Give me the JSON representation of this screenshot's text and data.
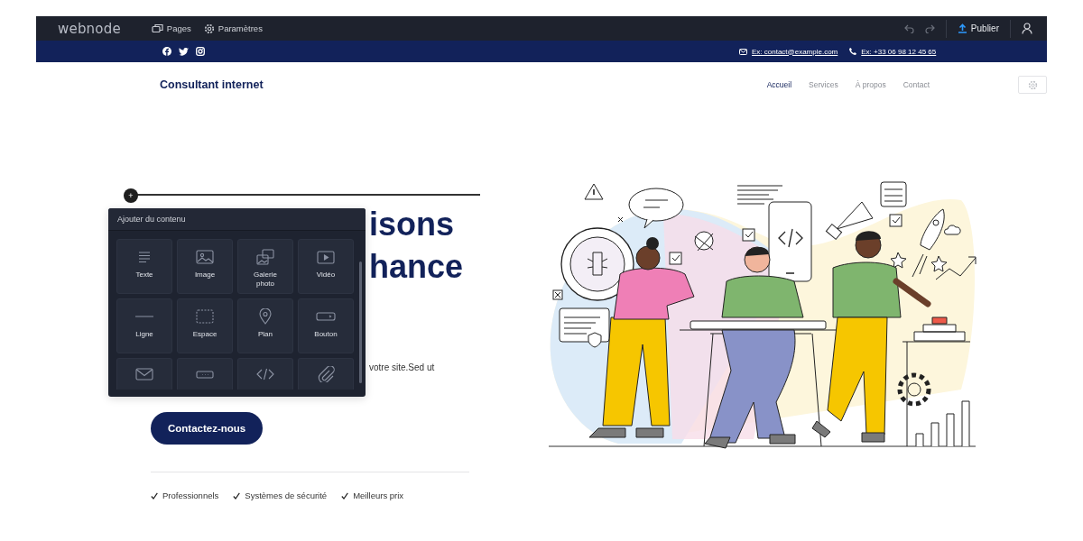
{
  "editor_bar": {
    "logo": "webnode",
    "menu": [
      {
        "kind": "pages",
        "label": "Pages"
      },
      {
        "kind": "settings",
        "label": "Paramètres"
      }
    ],
    "publish": "Publier"
  },
  "contact_bar": {
    "email": "Ex: contact@example.com",
    "phone": "Ex: +33 06 98 12 45 65"
  },
  "site_header": {
    "brand": "Consultant internet",
    "nav": [
      {
        "label": "Accueil",
        "selected": true
      },
      {
        "label": "Services",
        "selected": false
      },
      {
        "label": "À propos",
        "selected": false
      },
      {
        "label": "Contact",
        "selected": false
      }
    ]
  },
  "hero": {
    "heading_lines": [
      "isons",
      "hance"
    ],
    "text": "votre site.Sed ut",
    "button": "Contactez-nous",
    "features": [
      "Professionnels",
      "Systèmes de sécurité",
      "Meilleurs prix"
    ]
  },
  "add_button": "+",
  "add_content_panel": {
    "title": "Ajouter du contenu",
    "items": [
      {
        "kind": "text",
        "label": "Texte"
      },
      {
        "kind": "image",
        "label": "Image"
      },
      {
        "kind": "gallery",
        "label": "Galerie photo"
      },
      {
        "kind": "video",
        "label": "Vidéo"
      },
      {
        "kind": "line",
        "label": "Ligne"
      },
      {
        "kind": "space",
        "label": "Espace"
      },
      {
        "kind": "map",
        "label": "Plan"
      },
      {
        "kind": "button",
        "label": "Bouton"
      },
      {
        "kind": "mail"
      },
      {
        "kind": "field"
      },
      {
        "kind": "code"
      },
      {
        "kind": "clip"
      }
    ]
  }
}
